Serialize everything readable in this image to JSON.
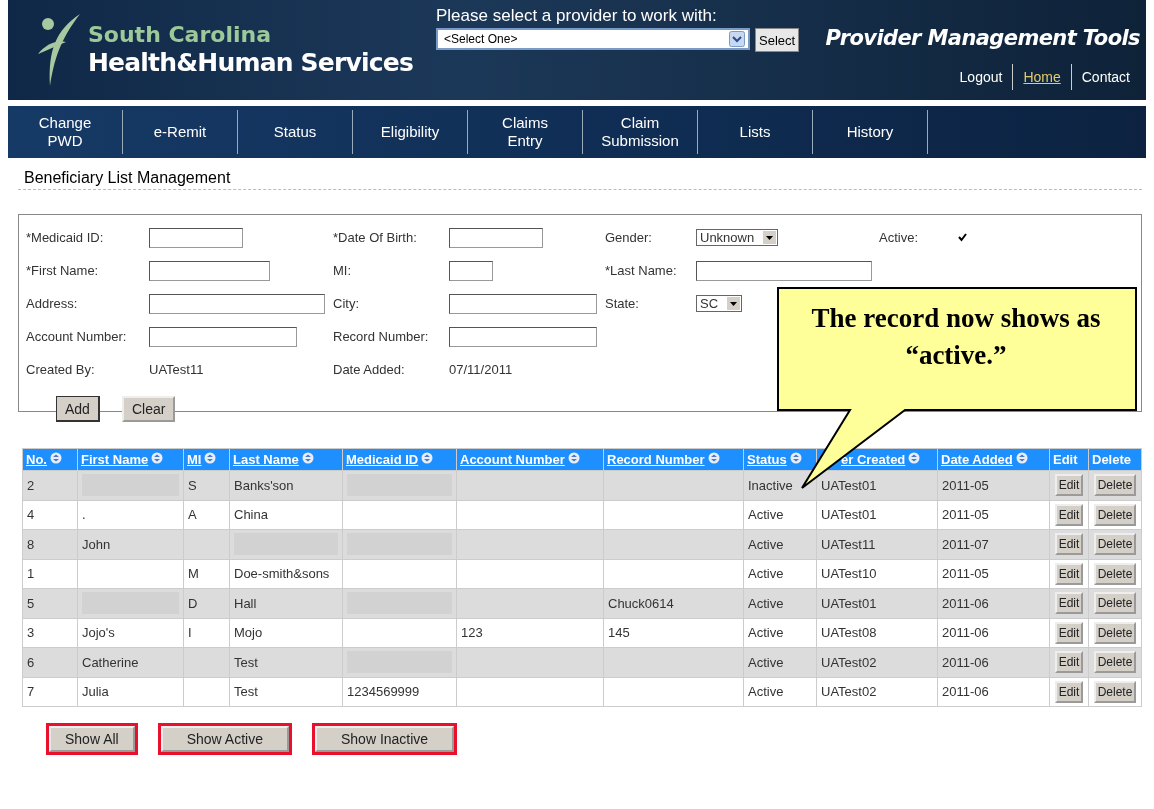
{
  "header": {
    "logo_line1": "South Carolina",
    "logo_line2": "Health&Human Services",
    "provider_prompt": "Please select a provider to work with:",
    "provider_select": "<Select One>",
    "select_button": "Select",
    "tool_title": "Provider Management Tools",
    "links": [
      {
        "label": "Logout",
        "selected": false
      },
      {
        "label": "Home",
        "selected": true
      },
      {
        "label": "Contact",
        "selected": false
      }
    ]
  },
  "nav": [
    {
      "label": "Change\nPWD"
    },
    {
      "label": "e-Remit"
    },
    {
      "label": "Status"
    },
    {
      "label": "Eligibility"
    },
    {
      "label": "Claims\nEntry"
    },
    {
      "label": "Claim\nSubmission"
    },
    {
      "label": "Lists"
    },
    {
      "label": "History"
    }
  ],
  "section_title": "Beneficiary List Management",
  "form": {
    "rows": [
      [
        {
          "label": "*Medicaid ID:",
          "kind": "input"
        },
        {
          "label": "*Date Of Birth:",
          "kind": "input"
        },
        {
          "label": "Gender:",
          "kind": "select",
          "value": "Unknown"
        },
        {
          "label": "Active:",
          "kind": "checkbox",
          "checked": true
        }
      ],
      [
        {
          "label": "*First Name:",
          "kind": "input"
        },
        {
          "label": "MI:",
          "kind": "input"
        },
        {
          "label": "*Last Name:",
          "kind": "input"
        }
      ],
      [
        {
          "label": "Address:",
          "kind": "input"
        },
        {
          "label": "City:",
          "kind": "input"
        },
        {
          "label": "State:",
          "kind": "select",
          "value": "SC"
        }
      ],
      [
        {
          "label": "Account Number:",
          "kind": "input"
        },
        {
          "label": "Record Number:",
          "kind": "input"
        }
      ],
      [
        {
          "label": "Created By:",
          "kind": "text",
          "value": "UATest11"
        },
        {
          "label": "Date Added:",
          "kind": "text",
          "value": "07/11/2011"
        }
      ]
    ],
    "buttons": [
      "Add",
      "Clear"
    ]
  },
  "callout": "The record now shows as “active.”",
  "table": {
    "columns": [
      {
        "label": "No.",
        "sortable": true
      },
      {
        "label": "First Name",
        "sortable": true
      },
      {
        "label": "MI",
        "sortable": true
      },
      {
        "label": "Last Name",
        "sortable": true
      },
      {
        "label": "Medicaid ID",
        "sortable": true
      },
      {
        "label": "Account Number",
        "sortable": true
      },
      {
        "label": "Record Number",
        "sortable": true
      },
      {
        "label": "Status",
        "sortable": true
      },
      {
        "label": "er Created",
        "sortable": true
      },
      {
        "label": "Date Added",
        "sortable": true
      },
      {
        "label": "Edit",
        "sortable": false
      },
      {
        "label": "Delete",
        "sortable": false
      }
    ],
    "rows": [
      {
        "cells": [
          {
            "kind": "text",
            "text": "2"
          },
          {
            "kind": "redacted"
          },
          {
            "kind": "text",
            "text": "S"
          },
          {
            "kind": "text",
            "text": "Banks'son"
          },
          {
            "kind": "redacted"
          },
          {
            "kind": "empty"
          },
          {
            "kind": "empty"
          },
          {
            "kind": "text",
            "text": "Inactive"
          },
          {
            "kind": "text",
            "text": "UATest01"
          },
          {
            "kind": "text",
            "text": "2011-05"
          }
        ],
        "actions": [
          "Edit",
          "Delete"
        ]
      },
      {
        "cells": [
          {
            "kind": "text",
            "text": "4"
          },
          {
            "kind": "text",
            "text": "."
          },
          {
            "kind": "text",
            "text": "A"
          },
          {
            "kind": "text",
            "text": "China"
          },
          {
            "kind": "empty"
          },
          {
            "kind": "empty"
          },
          {
            "kind": "empty"
          },
          {
            "kind": "text",
            "text": "Active"
          },
          {
            "kind": "text",
            "text": "UATest01"
          },
          {
            "kind": "text",
            "text": "2011-05"
          }
        ],
        "actions": [
          "Edit",
          "Delete"
        ]
      },
      {
        "cells": [
          {
            "kind": "text",
            "text": "8"
          },
          {
            "kind": "text",
            "text": "John"
          },
          {
            "kind": "empty"
          },
          {
            "kind": "redacted"
          },
          {
            "kind": "redacted"
          },
          {
            "kind": "empty"
          },
          {
            "kind": "empty"
          },
          {
            "kind": "text",
            "text": "Active"
          },
          {
            "kind": "text",
            "text": "UATest11"
          },
          {
            "kind": "text",
            "text": "2011-07"
          }
        ],
        "actions": [
          "Edit",
          "Delete"
        ]
      },
      {
        "cells": [
          {
            "kind": "text",
            "text": "1"
          },
          {
            "kind": "empty"
          },
          {
            "kind": "text",
            "text": "M"
          },
          {
            "kind": "text",
            "text": "Doe-smith&sons"
          },
          {
            "kind": "empty"
          },
          {
            "kind": "empty"
          },
          {
            "kind": "empty"
          },
          {
            "kind": "text",
            "text": "Active"
          },
          {
            "kind": "text",
            "text": "UATest10"
          },
          {
            "kind": "text",
            "text": "2011-05"
          }
        ],
        "actions": [
          "Edit",
          "Delete"
        ]
      },
      {
        "cells": [
          {
            "kind": "text",
            "text": "5"
          },
          {
            "kind": "redacted"
          },
          {
            "kind": "text",
            "text": "D"
          },
          {
            "kind": "text",
            "text": "Hall"
          },
          {
            "kind": "redacted"
          },
          {
            "kind": "empty"
          },
          {
            "kind": "text",
            "text": "Chuck0614"
          },
          {
            "kind": "text",
            "text": "Active"
          },
          {
            "kind": "text",
            "text": "UATest01"
          },
          {
            "kind": "text",
            "text": "2011-06"
          }
        ],
        "actions": [
          "Edit",
          "Delete"
        ]
      },
      {
        "cells": [
          {
            "kind": "text",
            "text": "3"
          },
          {
            "kind": "text",
            "text": "Jojo's"
          },
          {
            "kind": "text",
            "text": "I"
          },
          {
            "kind": "text",
            "text": "Mojo"
          },
          {
            "kind": "empty"
          },
          {
            "kind": "text",
            "text": "123"
          },
          {
            "kind": "text",
            "text": "145"
          },
          {
            "kind": "text",
            "text": "Active"
          },
          {
            "kind": "text",
            "text": "UATest08"
          },
          {
            "kind": "text",
            "text": "2011-06"
          }
        ],
        "actions": [
          "Edit",
          "Delete"
        ]
      },
      {
        "cells": [
          {
            "kind": "text",
            "text": "6"
          },
          {
            "kind": "text",
            "text": "Catherine"
          },
          {
            "kind": "empty"
          },
          {
            "kind": "text",
            "text": "Test"
          },
          {
            "kind": "redacted"
          },
          {
            "kind": "empty"
          },
          {
            "kind": "empty"
          },
          {
            "kind": "text",
            "text": "Active"
          },
          {
            "kind": "text",
            "text": "UATest02"
          },
          {
            "kind": "text",
            "text": "2011-06"
          }
        ],
        "actions": [
          "Edit",
          "Delete"
        ]
      },
      {
        "cells": [
          {
            "kind": "text",
            "text": "7"
          },
          {
            "kind": "text",
            "text": "Julia"
          },
          {
            "kind": "empty"
          },
          {
            "kind": "text",
            "text": "Test"
          },
          {
            "kind": "text",
            "text": "1234569999"
          },
          {
            "kind": "empty"
          },
          {
            "kind": "empty"
          },
          {
            "kind": "text",
            "text": "Active"
          },
          {
            "kind": "text",
            "text": "UATest02"
          },
          {
            "kind": "text",
            "text": "2011-06"
          }
        ],
        "actions": [
          "Edit",
          "Delete"
        ]
      }
    ]
  },
  "filter_buttons": [
    {
      "label": "Show All",
      "highlighted": true
    },
    {
      "label": "Show Active",
      "highlighted": true
    },
    {
      "label": "Show Inactive",
      "highlighted": true
    }
  ]
}
